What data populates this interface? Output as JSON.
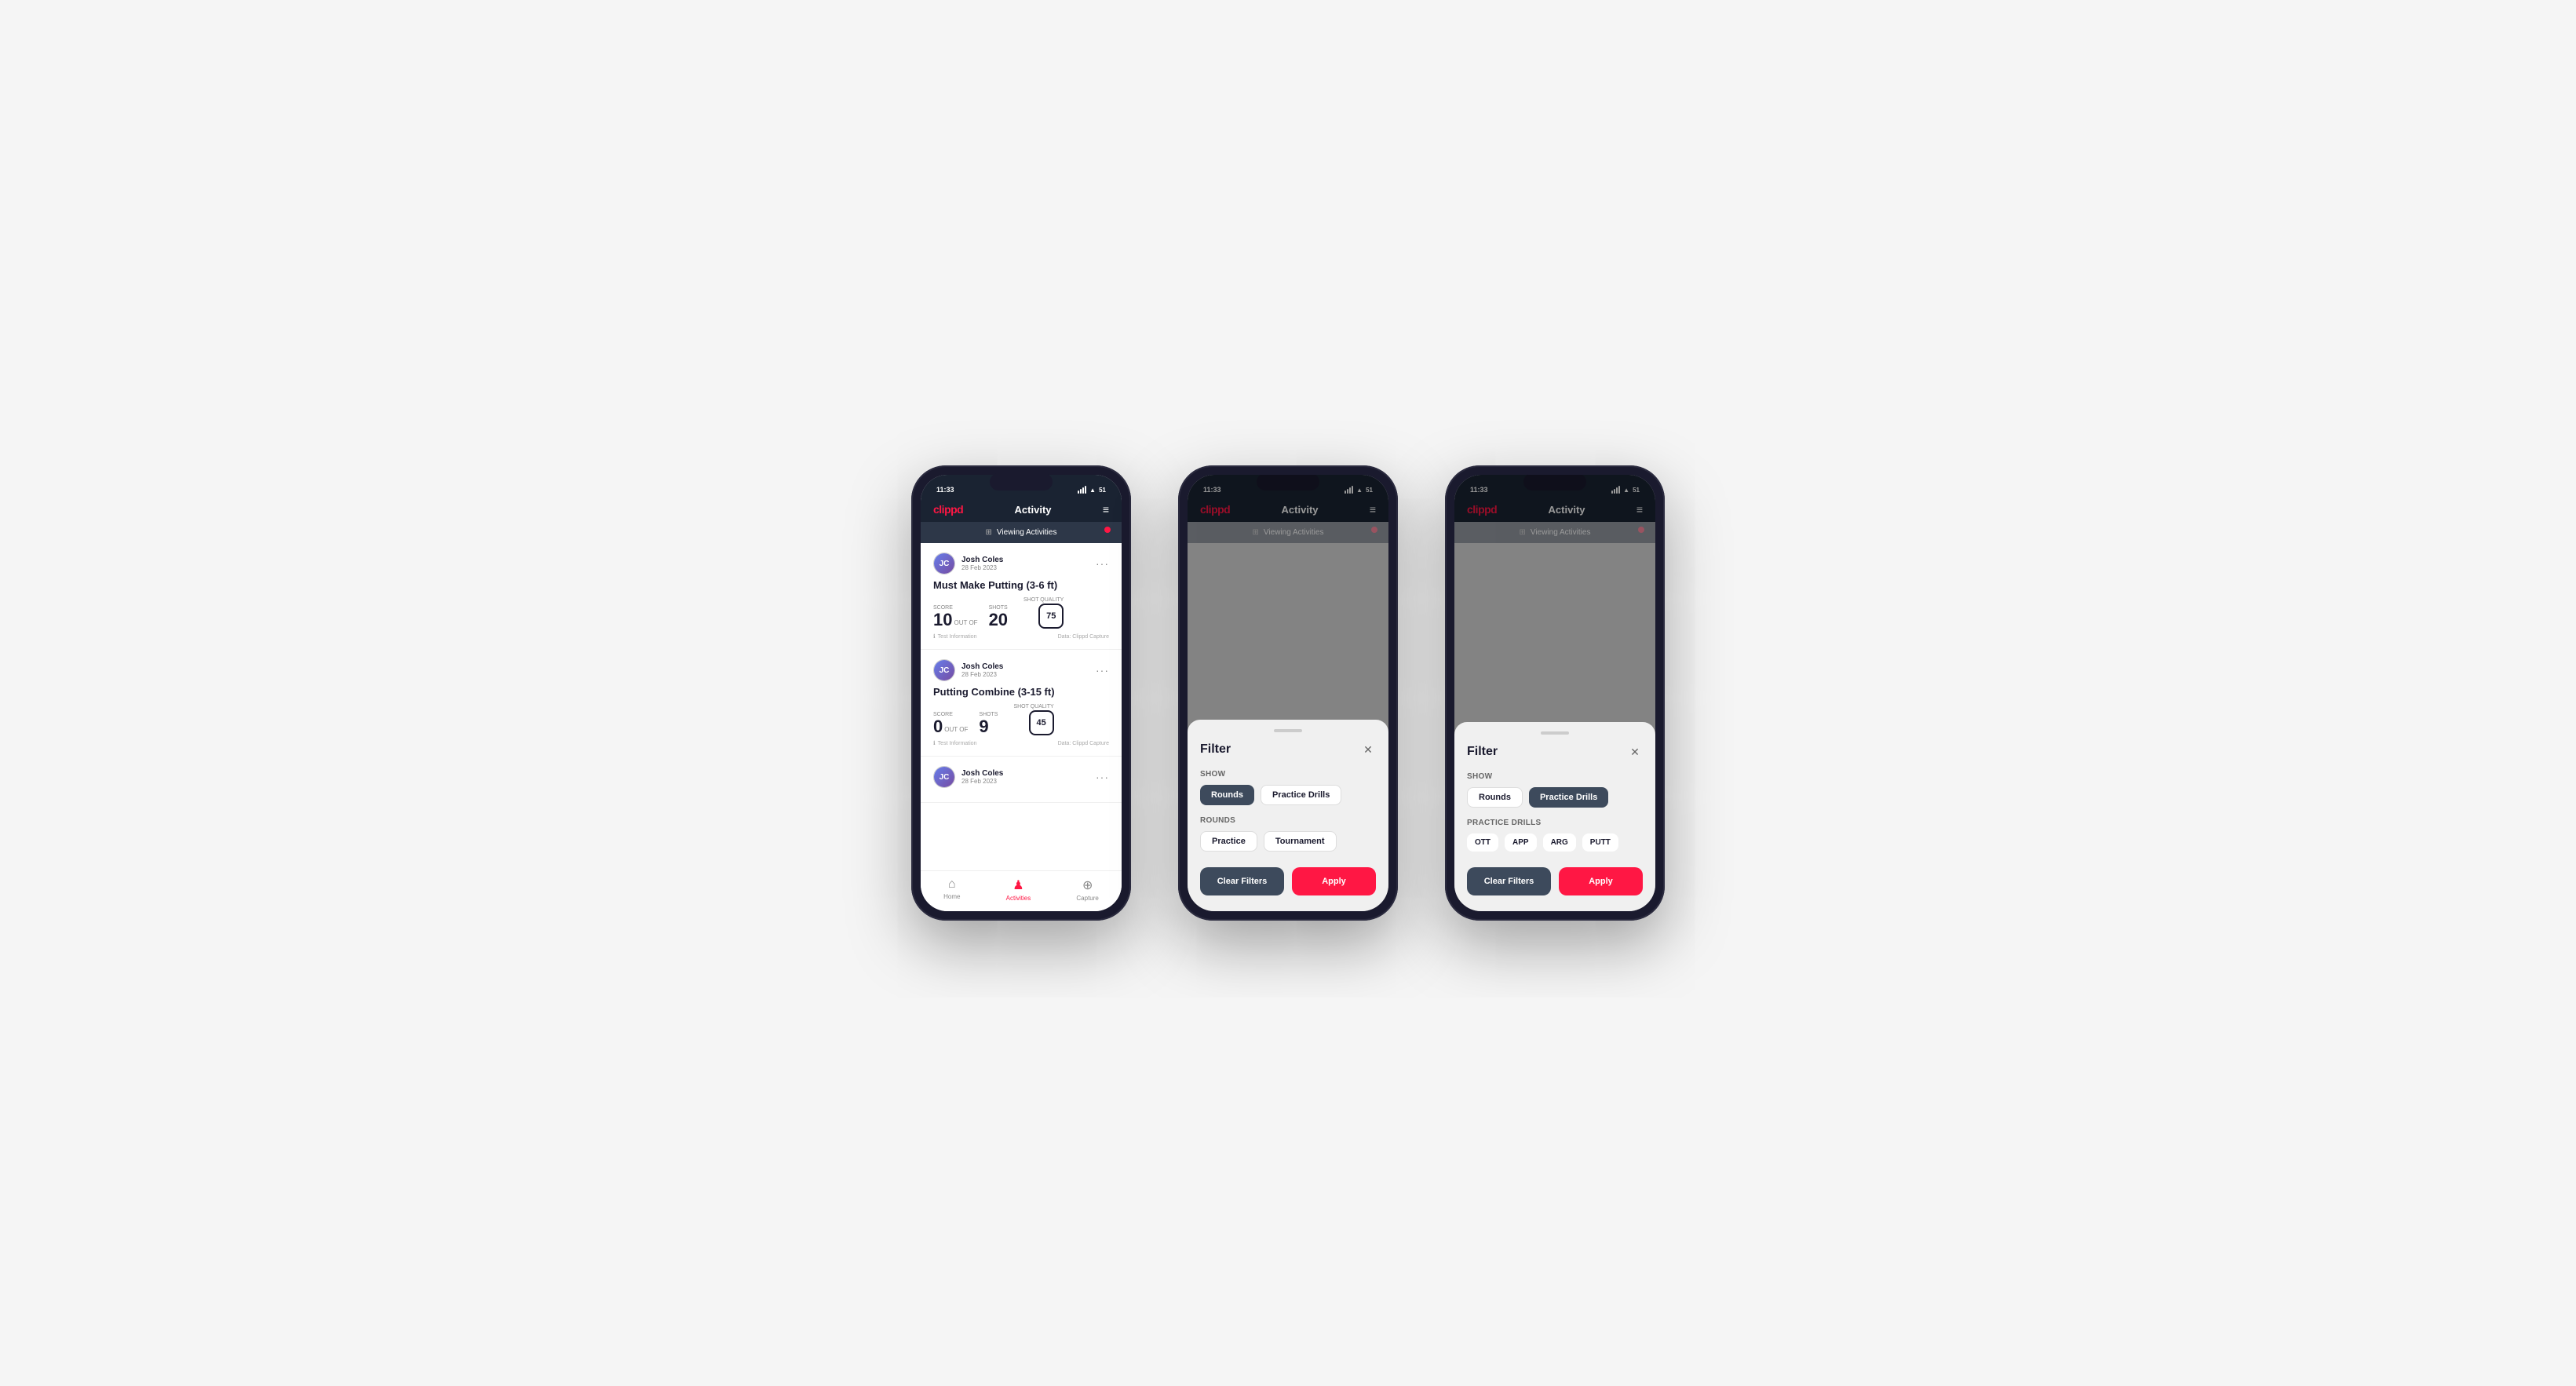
{
  "scene": {
    "background": "#f5f5f5"
  },
  "phones": [
    {
      "id": "phone1",
      "type": "activity_list",
      "statusBar": {
        "time": "11:33",
        "signal": "●●●●",
        "wifi": "WiFi",
        "battery": "51"
      },
      "header": {
        "logo": "clippd",
        "title": "Activity",
        "menuIcon": "≡"
      },
      "viewingBar": {
        "icon": "⊞",
        "text": "Viewing Activities"
      },
      "cards": [
        {
          "userName": "Josh Coles",
          "userDate": "28 Feb 2023",
          "title": "Must Make Putting (3-6 ft)",
          "scoreLabel": "Score",
          "scoreValue": "10",
          "shotsLabel": "Shots",
          "shotsValue": "20",
          "shotQualityLabel": "Shot Quality",
          "shotQualityValue": "75",
          "testInfo": "Test Information",
          "dataSource": "Data: Clippd Capture"
        },
        {
          "userName": "Josh Coles",
          "userDate": "28 Feb 2023",
          "title": "Putting Combine (3-15 ft)",
          "scoreLabel": "Score",
          "scoreValue": "0",
          "shotsLabel": "Shots",
          "shotsValue": "9",
          "shotQualityLabel": "Shot Quality",
          "shotQualityValue": "45",
          "testInfo": "Test Information",
          "dataSource": "Data: Clippd Capture"
        },
        {
          "userName": "Josh Coles",
          "userDate": "28 Feb 2023",
          "title": "",
          "partial": true
        }
      ],
      "bottomNav": [
        {
          "icon": "⌂",
          "label": "Home",
          "active": false
        },
        {
          "icon": "♟",
          "label": "Activities",
          "active": true
        },
        {
          "icon": "⊕",
          "label": "Capture",
          "active": false
        }
      ]
    },
    {
      "id": "phone2",
      "type": "filter_rounds",
      "statusBar": {
        "time": "11:33",
        "signal": "●●●●",
        "wifi": "WiFi",
        "battery": "51"
      },
      "header": {
        "logo": "clippd",
        "title": "Activity",
        "menuIcon": "≡"
      },
      "viewingBar": {
        "icon": "⊞",
        "text": "Viewing Activities"
      },
      "filter": {
        "title": "Filter",
        "showLabel": "Show",
        "showChips": [
          {
            "label": "Rounds",
            "active": true
          },
          {
            "label": "Practice Drills",
            "active": false
          }
        ],
        "roundsLabel": "Rounds",
        "roundsChips": [
          {
            "label": "Practice",
            "active": false
          },
          {
            "label": "Tournament",
            "active": false
          }
        ],
        "clearLabel": "Clear Filters",
        "applyLabel": "Apply"
      }
    },
    {
      "id": "phone3",
      "type": "filter_practice",
      "statusBar": {
        "time": "11:33",
        "signal": "●●●●",
        "wifi": "WiFi",
        "battery": "51"
      },
      "header": {
        "logo": "clippd",
        "title": "Activity",
        "menuIcon": "≡"
      },
      "viewingBar": {
        "icon": "⊞",
        "text": "Viewing Activities"
      },
      "filter": {
        "title": "Filter",
        "showLabel": "Show",
        "showChips": [
          {
            "label": "Rounds",
            "active": false
          },
          {
            "label": "Practice Drills",
            "active": true
          }
        ],
        "practiceDrillsLabel": "Practice Drills",
        "practiceDrillsChips": [
          {
            "label": "OTT",
            "active": false
          },
          {
            "label": "APP",
            "active": false
          },
          {
            "label": "ARG",
            "active": false
          },
          {
            "label": "PUTT",
            "active": false
          }
        ],
        "clearLabel": "Clear Filters",
        "applyLabel": "Apply"
      }
    }
  ]
}
